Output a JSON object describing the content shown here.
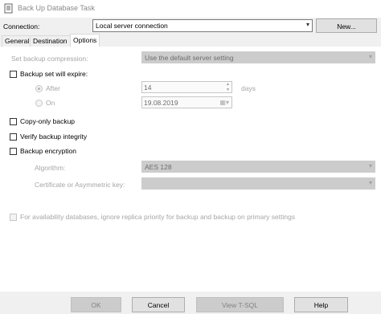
{
  "window": {
    "title": "Back Up Database Task"
  },
  "connection": {
    "label": "Connection:",
    "value": "Local server connection",
    "new_button": "New..."
  },
  "tabs": [
    {
      "label": "General"
    },
    {
      "label": "Destination"
    },
    {
      "label": "Options",
      "active": true
    }
  ],
  "options": {
    "compression_label": "Set backup compression:",
    "compression_value": "Use the default server setting",
    "expire_label": "Backup set will expire:",
    "after_label": "After",
    "after_value": "14",
    "after_unit": "days",
    "on_label": "On",
    "on_value": "19.08.2019",
    "copy_only_label": "Copy-only backup",
    "verify_label": "Verify backup integrity",
    "encryption_label": "Backup encryption",
    "algorithm_label": "Algorithm:",
    "algorithm_value": "AES 128",
    "cert_label": "Certificate or Asymmetric key:",
    "cert_value": "",
    "availability_label": "For availability databases, ignore replica priority for backup and backup on primary settings"
  },
  "buttons": {
    "ok": "OK",
    "cancel": "Cancel",
    "view_tsql": "View T-SQL",
    "help": "Help"
  },
  "colors": {
    "panel_bg": "#ffffff",
    "dialog_bg": "#f0f0f0",
    "disabled_text": "#a5a5a5"
  }
}
